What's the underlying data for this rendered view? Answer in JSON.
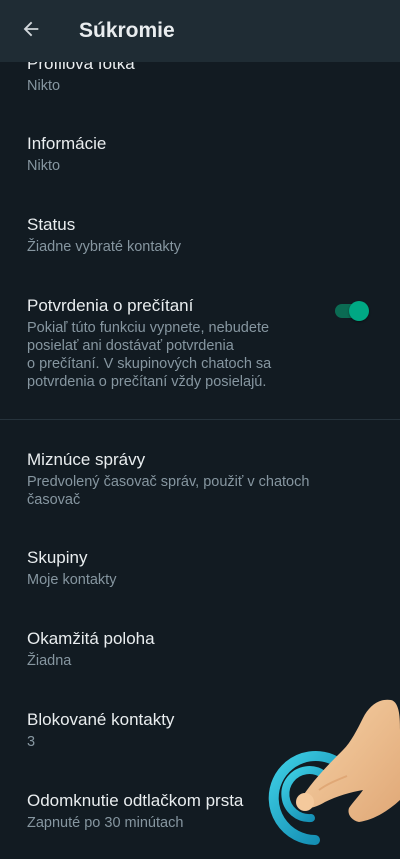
{
  "header": {
    "title": "Súkromie",
    "back_icon": "arrow-left-icon"
  },
  "items": [
    {
      "title": "Profilová fotka",
      "subtitle": "Nikto"
    },
    {
      "title": "Informácie",
      "subtitle": "Nikto"
    },
    {
      "title": "Status",
      "subtitle": "Žiadne vybraté kontakty"
    },
    {
      "title": "Potvrdenia o prečítaní",
      "subtitle_lines": [
        "Pokiaľ túto funkciu vypnete, nebudete",
        "posielať ani dostávať potvrdenia",
        "o prečítaní. V skupinových chatoch sa",
        "potvrdenia o prečítaní vždy posielajú."
      ],
      "toggle_on": true
    },
    {
      "title": "Miznúce správy",
      "subtitle_lines": [
        "Predvolený časovač správ, použiť v chatoch",
        "časovač"
      ]
    },
    {
      "title": "Skupiny",
      "subtitle": "Moje kontakty"
    },
    {
      "title": "Okamžitá poloha",
      "subtitle": "Žiadna"
    },
    {
      "title": "Blokované kontakty",
      "subtitle": "3"
    },
    {
      "title": "Odomknutie odtlačkom prsta",
      "subtitle": "Zapnuté po 30 minútach"
    }
  ],
  "colors": {
    "background": "#121b22",
    "appbar": "#1f2c34",
    "accent": "#00a884",
    "text_primary": "#e9edef",
    "text_secondary": "#8696a0"
  },
  "overlay": {
    "icon": "tap-gesture-hand-icon"
  }
}
